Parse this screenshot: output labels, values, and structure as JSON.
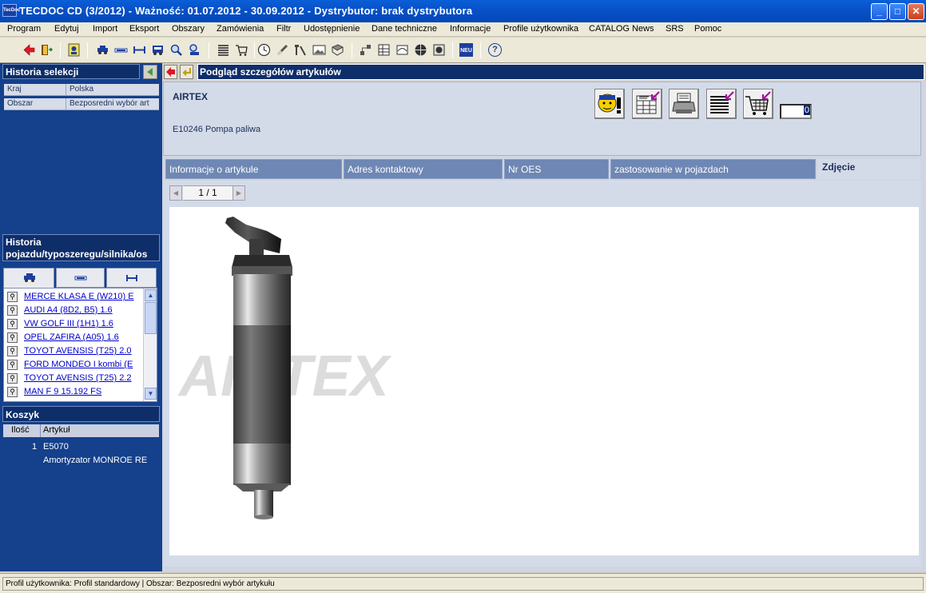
{
  "window": {
    "title": "TECDOC CD (3/2012)  -  Ważność: 01.07.2012 - 30.09.2012  -  Dystrybutor: brak dystrybutora",
    "app_icon_text": "TecDoc",
    "minimize": "_",
    "maximize": "□",
    "close": "✕"
  },
  "menu": [
    "Program",
    "Edytuj",
    "Import",
    "Eksport",
    "Obszary",
    "Zamówienia",
    "Filtr",
    "Udostępnienie",
    "Dane techniczne",
    "Informacje",
    "Profile użytkownika",
    "CATALOG News",
    "SRS",
    "Pomoc"
  ],
  "toolbar": {
    "icons": [
      "back-arrow-icon",
      "exit-door-icon",
      "user-id-icon",
      "car-icon",
      "truck-axle-icon",
      "axle-icon",
      "bus-icon",
      "search-magnifier-icon",
      "person-search-icon",
      "list-icon",
      "cart-list-icon",
      "clock-icon",
      "spark-plug-icon",
      "tools-icon",
      "photo-icon",
      "book-icon",
      "network-icon",
      "grid-tool-icon",
      "engine-icon",
      "globe-icon",
      "settings-icon",
      "new-badge-icon",
      "help-icon"
    ],
    "new_badge": "NEU",
    "help": "?"
  },
  "left": {
    "history_selection": {
      "title": "Historia selekcji",
      "rows": [
        {
          "key": "Kraj",
          "value": "Polska"
        },
        {
          "key": "Obszar",
          "value": "Bezposredni wybór art"
        }
      ]
    },
    "vehicle_history": {
      "title_line1": "Historia",
      "title_line2": "pojazdu/typoszeregu/silnika/os",
      "items": [
        "MERCE KLASA E (W210) E",
        "AUDI A4 (8D2, B5) 1.6",
        "VW GOLF III (1H1) 1.6",
        "OPEL ZAFIRA (A05) 1.6",
        "TOYOT AVENSIS (T25) 2.0",
        "FORD MONDEO I kombi (E",
        "TOYOT AVENSIS (T25) 2.2",
        "MAN F 9 15.192 FS"
      ]
    },
    "basket": {
      "title": "Koszyk",
      "col_qty": "Ilość",
      "col_article": "Artykuł",
      "qty": "1",
      "article_no": "E5070",
      "article_desc": "Amortyzator MONROE RE"
    }
  },
  "main": {
    "title": "Podgląd szczegółów artykułów",
    "brand": "AIRTEX",
    "article": "E10246 Pompa paliwa",
    "quantity": "0",
    "tabs": [
      {
        "label": "Informacje o artykule",
        "active": false
      },
      {
        "label": "Adres kontaktowy",
        "active": false
      },
      {
        "label": "Nr OES",
        "active": false
      },
      {
        "label": "zastosowanie w pojazdach",
        "active": false
      },
      {
        "label": "Zdjęcie",
        "active": true
      }
    ],
    "pager": "1  /  1",
    "watermark": "AIRTEX"
  },
  "status": "Profil użytkownika: Profil standardowy | Obszar: Bezposredni wybór artykułu",
  "colors": {
    "titlebar": "#0852c8",
    "panel_bg": "#14408c",
    "header_bg": "#0e2e6a",
    "tab_bg": "#6e87b4",
    "link": "#0000cc"
  }
}
